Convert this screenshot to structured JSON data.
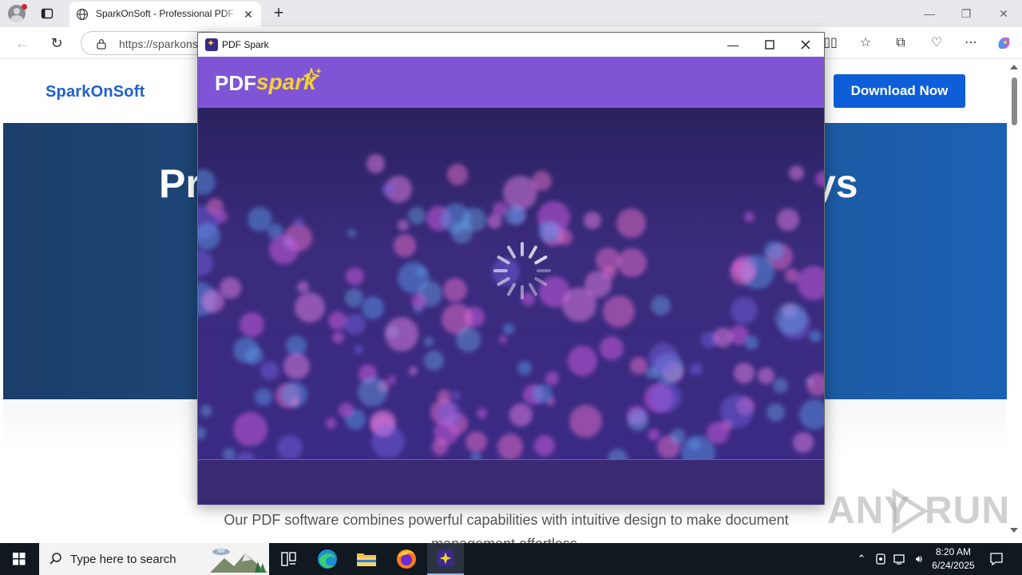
{
  "browser": {
    "tab_title": "SparkOnSoft - Professional PDF Software",
    "tab_close": "✕",
    "new_tab": "+",
    "url": "https://sparkonsoft.com",
    "window_minimize": "—",
    "window_restore": "❐",
    "window_close": "✕"
  },
  "site": {
    "logo": "SparkOnSoft",
    "download_label": "Download Now",
    "hero_title_start": "Pr",
    "hero_title_end": "ys",
    "description": "Our PDF software combines powerful capabilities with intuitive design to make document management effortless."
  },
  "app": {
    "window_title": "PDF Spark",
    "brand_pdf": "PDF",
    "brand_spark": "spark",
    "loading": true,
    "accent_color": "#7f55d6",
    "spark_color": "#f3d233"
  },
  "taskbar": {
    "search_placeholder": "Type here to search",
    "time": "8:20 AM",
    "date": "6/24/2025",
    "pinned": [
      "task-view-icon",
      "edge-icon",
      "file-explorer-icon",
      "firefox-icon",
      "pdf-spark-icon"
    ]
  },
  "watermark": {
    "text_left": "ANY",
    "text_right": "RUN"
  }
}
